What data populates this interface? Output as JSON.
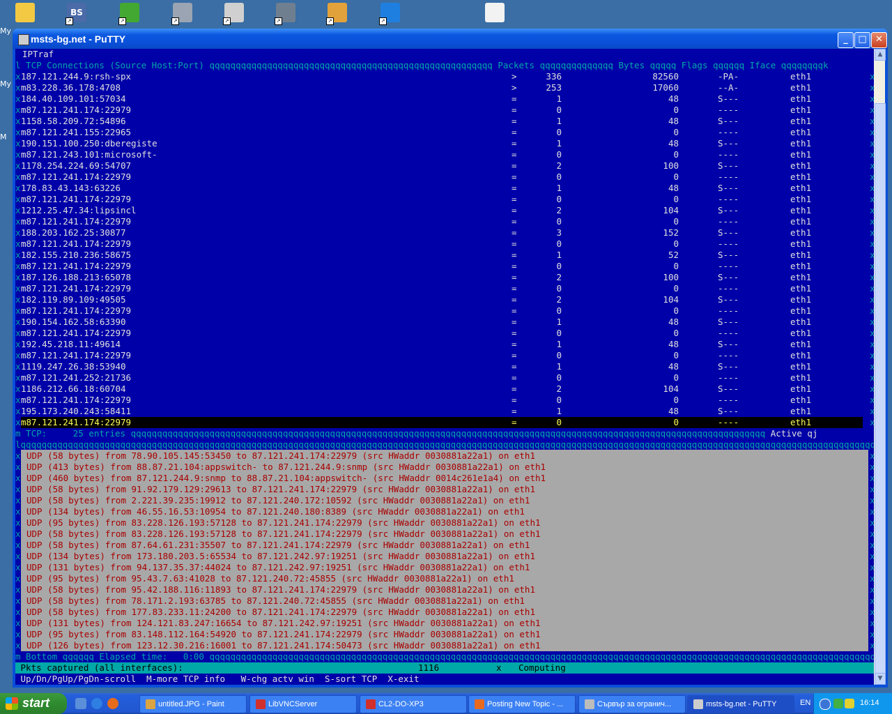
{
  "desktop": {
    "side_labels": [
      "My",
      "My",
      "M"
    ],
    "icons": [
      {
        "name": "folder-icon",
        "color": "#f3c944"
      },
      {
        "name": "bs-player-icon",
        "color": "#4a6aa8",
        "label": "BS"
      },
      {
        "name": "icq-flower-icon",
        "color": "#43a832"
      },
      {
        "name": "monitor-app-icon",
        "color": "#9aa4b2"
      },
      {
        "name": "network-putty-icon",
        "color": "#d0d0d0"
      },
      {
        "name": "lock-network-icon",
        "color": "#6f7f8f"
      },
      {
        "name": "flashget-icon",
        "color": "#e2a23b"
      },
      {
        "name": "teamviewer-icon",
        "color": "#1f7fe0"
      },
      {
        "name": "document-icon",
        "color": "#f2f2f2"
      }
    ]
  },
  "window": {
    "title": "msts-bg.net - PuTTY",
    "buttons": {
      "minimize": "_",
      "maximize": "□",
      "close": "✕"
    }
  },
  "iptraf": {
    "app_name": "IPTraf",
    "header": {
      "prefix": "l TCP Connections (Source Host:Port) ",
      "fill1": "qqqqqqqqqqqqqqqqqqqqqqqqqqqqqqqqqqqqqqqqqqqqqqqqqqqqqq ",
      "packets": "Packets ",
      "fill2": "qqqqqqqqqqqqqq ",
      "bytes": "Bytes ",
      "fill3": "qqqqq ",
      "flags": "Flags ",
      "fill4": "qqqqqq ",
      "iface": "Iface ",
      "fill5": "qqqqqqqqk"
    },
    "rows": [
      {
        "host": "187.121.244.9:rsh-spx",
        "dir": ">",
        "packets": "336",
        "bytes": "82560",
        "flags": "-PA-",
        "iface": "eth1"
      },
      {
        "host": "m83.228.36.178:4708",
        "dir": ">",
        "packets": "253",
        "bytes": "17060",
        "flags": "--A-",
        "iface": "eth1"
      },
      {
        "host": "184.40.109.101:57034",
        "dir": "=",
        "packets": "1",
        "bytes": "48",
        "flags": "S---",
        "iface": "eth1"
      },
      {
        "host": "m87.121.241.174:22979",
        "dir": "=",
        "packets": "0",
        "bytes": "0",
        "flags": "----",
        "iface": "eth1"
      },
      {
        "host": "1158.58.209.72:54896",
        "dir": "=",
        "packets": "1",
        "bytes": "48",
        "flags": "S---",
        "iface": "eth1"
      },
      {
        "host": "m87.121.241.155:22965",
        "dir": "=",
        "packets": "0",
        "bytes": "0",
        "flags": "----",
        "iface": "eth1"
      },
      {
        "host": "190.151.100.250:dberegiste",
        "dir": "=",
        "packets": "1",
        "bytes": "48",
        "flags": "S---",
        "iface": "eth1"
      },
      {
        "host": "m87.121.243.101:microsoft-",
        "dir": "=",
        "packets": "0",
        "bytes": "0",
        "flags": "----",
        "iface": "eth1"
      },
      {
        "host": "1178.254.224.69:54707",
        "dir": "=",
        "packets": "2",
        "bytes": "100",
        "flags": "S---",
        "iface": "eth1"
      },
      {
        "host": "m87.121.241.174:22979",
        "dir": "=",
        "packets": "0",
        "bytes": "0",
        "flags": "----",
        "iface": "eth1"
      },
      {
        "host": "178.83.43.143:63226",
        "dir": "=",
        "packets": "1",
        "bytes": "48",
        "flags": "S---",
        "iface": "eth1"
      },
      {
        "host": "m87.121.241.174:22979",
        "dir": "=",
        "packets": "0",
        "bytes": "0",
        "flags": "----",
        "iface": "eth1"
      },
      {
        "host": "1212.25.47.34:lipsincl",
        "dir": "=",
        "packets": "2",
        "bytes": "104",
        "flags": "S---",
        "iface": "eth1"
      },
      {
        "host": "m87.121.241.174:22979",
        "dir": "=",
        "packets": "0",
        "bytes": "0",
        "flags": "----",
        "iface": "eth1"
      },
      {
        "host": "188.203.162.25:30877",
        "dir": "=",
        "packets": "3",
        "bytes": "152",
        "flags": "S---",
        "iface": "eth1"
      },
      {
        "host": "m87.121.241.174:22979",
        "dir": "=",
        "packets": "0",
        "bytes": "0",
        "flags": "----",
        "iface": "eth1"
      },
      {
        "host": "182.155.210.236:58675",
        "dir": "=",
        "packets": "1",
        "bytes": "52",
        "flags": "S---",
        "iface": "eth1"
      },
      {
        "host": "m87.121.241.174:22979",
        "dir": "=",
        "packets": "0",
        "bytes": "0",
        "flags": "----",
        "iface": "eth1"
      },
      {
        "host": "187.126.188.213:65078",
        "dir": "=",
        "packets": "2",
        "bytes": "100",
        "flags": "S---",
        "iface": "eth1"
      },
      {
        "host": "m87.121.241.174:22979",
        "dir": "=",
        "packets": "0",
        "bytes": "0",
        "flags": "----",
        "iface": "eth1"
      },
      {
        "host": "182.119.89.109:49505",
        "dir": "=",
        "packets": "2",
        "bytes": "104",
        "flags": "S---",
        "iface": "eth1"
      },
      {
        "host": "m87.121.241.174:22979",
        "dir": "=",
        "packets": "0",
        "bytes": "0",
        "flags": "----",
        "iface": "eth1"
      },
      {
        "host": "190.154.162.58:63390",
        "dir": "=",
        "packets": "1",
        "bytes": "48",
        "flags": "S---",
        "iface": "eth1"
      },
      {
        "host": "m87.121.241.174:22979",
        "dir": "=",
        "packets": "0",
        "bytes": "0",
        "flags": "----",
        "iface": "eth1"
      },
      {
        "host": "192.45.218.11:49614",
        "dir": "=",
        "packets": "1",
        "bytes": "48",
        "flags": "S---",
        "iface": "eth1"
      },
      {
        "host": "m87.121.241.174:22979",
        "dir": "=",
        "packets": "0",
        "bytes": "0",
        "flags": "----",
        "iface": "eth1"
      },
      {
        "host": "1119.247.26.38:53940",
        "dir": "=",
        "packets": "1",
        "bytes": "48",
        "flags": "S---",
        "iface": "eth1"
      },
      {
        "host": "m87.121.241.252:21736",
        "dir": "=",
        "packets": "0",
        "bytes": "0",
        "flags": "----",
        "iface": "eth1"
      },
      {
        "host": "1186.212.66.18:60704",
        "dir": "=",
        "packets": "2",
        "bytes": "104",
        "flags": "S---",
        "iface": "eth1"
      },
      {
        "host": "m87.121.241.174:22979",
        "dir": "=",
        "packets": "0",
        "bytes": "0",
        "flags": "----",
        "iface": "eth1"
      },
      {
        "host": "195.173.240.243:58411",
        "dir": "=",
        "packets": "1",
        "bytes": "48",
        "flags": "S---",
        "iface": "eth1"
      },
      {
        "host": "m87.121.241.174:22979",
        "dir": "=",
        "packets": "0",
        "bytes": "0",
        "flags": "----",
        "iface": "eth1"
      }
    ],
    "tcp_footer": {
      "text": "m TCP:     25 entries ",
      "fill": "qqqqqqqqqqqqqqqqqqqqqqqqqqqqqqqqqqqqqqqqqqqqqqqqqqqqqqqqqqqqqqqqqqqqqqqqqqqqqqqqqqqqqqqqqqqqqqqqqqqqqqqqqqqqqqqqqqqqqqqqq ",
      "active": "Active qj"
    },
    "udp_top_border": "lqqqqqqqqqqqqqqqqqqqqqqqqqqqqqqqqqqqqqqqqqqqqqqqqqqqqqqqqqqqqqqqqqqqqqqqqqqqqqqqqqqqqqqqqqqqqqqqqqqqqqqqqqqqqqqqqqqqqqqqqqqqqqqqqqqqqqqqqqqqqqqqqqqqqqqqqqqqqqqqqqqqqqqqqqqqqqqqqqqqqqqqqqqqqqqqqqqqqqqqqqqqk",
    "udp_lines": [
      "UDP (58 bytes) from 78.90.105.145:53450 to 87.121.241.174:22979 (src HWaddr 0030881a22a1) on eth1",
      "UDP (413 bytes) from 88.87.21.104:appswitch- to 87.121.244.9:snmp (src HWaddr 0030881a22a1) on eth1",
      "UDP (460 bytes) from 87.121.244.9:snmp to 88.87.21.104:appswitch- (src HWaddr 0014c261e1a4) on eth1",
      "UDP (58 bytes) from 91.92.179.129:29613 to 87.121.241.174:22979 (src HWaddr 0030881a22a1) on eth1",
      "UDP (58 bytes) from 2.221.39.235:19912 to 87.121.240.172:10592 (src HWaddr 0030881a22a1) on eth1",
      "UDP (134 bytes) from 46.55.16.53:10954 to 87.121.240.180:8389 (src HWaddr 0030881a22a1) on eth1",
      "UDP (95 bytes) from 83.228.126.193:57128 to 87.121.241.174:22979 (src HWaddr 0030881a22a1) on eth1",
      "UDP (58 bytes) from 83.228.126.193:57128 to 87.121.241.174:22979 (src HWaddr 0030881a22a1) on eth1",
      "UDP (58 bytes) from 87.64.61.231:35507 to 87.121.241.174:22979 (src HWaddr 0030881a22a1) on eth1",
      "UDP (134 bytes) from 173.180.203.5:65534 to 87.121.242.97:19251 (src HWaddr 0030881a22a1) on eth1",
      "UDP (131 bytes) from 94.137.35.37:44024 to 87.121.242.97:19251 (src HWaddr 0030881a22a1) on eth1",
      "UDP (95 bytes) from 95.43.7.63:41028 to 87.121.240.72:45855 (src HWaddr 0030881a22a1) on eth1",
      "UDP (58 bytes) from 95.42.188.116:11893 to 87.121.241.174:22979 (src HWaddr 0030881a22a1) on eth1",
      "UDP (58 bytes) from 78.171.2.193:63785 to 87.121.240.72:45855 (src HWaddr 0030881a22a1) on eth1",
      "UDP (58 bytes) from 177.83.233.11:24200 to 87.121.241.174:22979 (src HWaddr 0030881a22a1) on eth1",
      "UDP (131 bytes) from 124.121.83.247:16654 to 87.121.242.97:19251 (src HWaddr 0030881a22a1) on eth1",
      "UDP (95 bytes) from 83.148.112.164:54920 to 87.121.241.174:22979 (src HWaddr 0030881a22a1) on eth1",
      "UDP (126 bytes) from 123.12.30.216:16001 to 87.121.241.174:50473 (src HWaddr 0030881a22a1) on eth1"
    ],
    "bottom_border": "m Bottom qqqqqq Elapsed time:   0:00 qqqqqqqqqqqqqqqqqqqqqqqqqqqqqqqqqqqqqqqqqqqqqqqqqqqqqqqqqqqqqqqqqqqqqqqqqqqqqqqqqqqqqqqqqqqqqqqqqqqqqqqqqqqqqqqqqqqqqqqqqqqqqqqqqqqqqqqqqqqqqqqqqqqqqqj",
    "status": {
      "label": " Pkts captured (all interfaces):",
      "value": "1116",
      "sep": "x",
      "computing": "Computing"
    },
    "help": " Up/Dn/PgUp/PgDn-scroll  M-more TCP info   W-chg actv win  S-sort TCP  X-exit"
  },
  "taskbar": {
    "start_label": "start",
    "tasks": [
      {
        "label": "untitled.JPG - Paint",
        "color": "#d9a441"
      },
      {
        "label": "LibVNCServer",
        "color": "#d2302c"
      },
      {
        "label": "CL2-DO-XP3",
        "color": "#d2302c"
      },
      {
        "label": "Posting New Topic - ...",
        "color": "#e86a1f"
      },
      {
        "label": "Сървър за огранич...",
        "color": "#bcbcbc"
      },
      {
        "label": "msts-bg.net - PuTTY",
        "color": "#cccccc"
      }
    ],
    "lang": "EN",
    "clock": "16:14"
  }
}
